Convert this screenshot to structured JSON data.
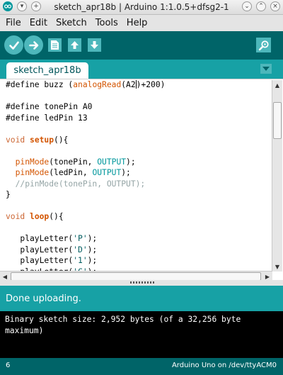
{
  "window": {
    "title": "sketch_apr18b | Arduino 1:1.0.5+dfsg2-1",
    "left_buttons": [
      "▾",
      "+"
    ],
    "right_buttons": [
      "⌄",
      "⌃",
      "×"
    ]
  },
  "menu": [
    "File",
    "Edit",
    "Sketch",
    "Tools",
    "Help"
  ],
  "toolbar": {
    "buttons": [
      "verify",
      "upload",
      "new",
      "open",
      "save"
    ],
    "serial_monitor": "serial-monitor"
  },
  "tabs": {
    "active": "sketch_apr18b"
  },
  "code": {
    "lines": [
      [
        {
          "t": "#define buzz "
        },
        {
          "t": "(",
          "c": "plain"
        },
        {
          "t": "analogRead",
          "c": "func"
        },
        {
          "t": "(A2"
        },
        {
          "caret": true
        },
        {
          "t": ")+200)"
        }
      ],
      [],
      [
        {
          "t": "#define tonePin A0"
        }
      ],
      [
        {
          "t": "#define ledPin 13"
        }
      ],
      [],
      [
        {
          "t": "void",
          "c": "type"
        },
        {
          "t": " "
        },
        {
          "t": "setup",
          "c": "funcbold"
        },
        {
          "t": "(){"
        }
      ],
      [],
      [
        {
          "t": "  "
        },
        {
          "t": "pinMode",
          "c": "func"
        },
        {
          "t": "(tonePin, "
        },
        {
          "t": "OUTPUT",
          "c": "const"
        },
        {
          "t": ");"
        }
      ],
      [
        {
          "t": "  "
        },
        {
          "t": "pinMode",
          "c": "func"
        },
        {
          "t": "(ledPin, "
        },
        {
          "t": "OUTPUT",
          "c": "const"
        },
        {
          "t": ");"
        }
      ],
      [
        {
          "t": "  //pinMode(tonePin, OUTPUT);",
          "c": "comment"
        }
      ],
      [
        {
          "t": "}"
        }
      ],
      [],
      [
        {
          "t": "void",
          "c": "type"
        },
        {
          "t": " "
        },
        {
          "t": "loop",
          "c": "funcbold"
        },
        {
          "t": "(){"
        }
      ],
      [],
      [
        {
          "t": "   playLetter("
        },
        {
          "t": "'P'",
          "c": "str"
        },
        {
          "t": ");"
        }
      ],
      [
        {
          "t": "   playLetter("
        },
        {
          "t": "'D'",
          "c": "str"
        },
        {
          "t": ");"
        }
      ],
      [
        {
          "t": "   playLetter("
        },
        {
          "t": "'1'",
          "c": "str"
        },
        {
          "t": ");"
        }
      ],
      [
        {
          "t": "   playLetter("
        },
        {
          "t": "'C'",
          "c": "str"
        },
        {
          "t": ");"
        }
      ]
    ]
  },
  "status": {
    "message": "Done uploading."
  },
  "console": {
    "output": "Binary sketch size: 2,952 bytes (of a 32,256 byte\nmaximum)"
  },
  "bottom": {
    "line": "6",
    "board": "Arduino Uno on /dev/ttyACM0"
  },
  "colors": {
    "toolbar": "#006468",
    "accent": "#17a1a5",
    "button": "#4db7bb"
  }
}
